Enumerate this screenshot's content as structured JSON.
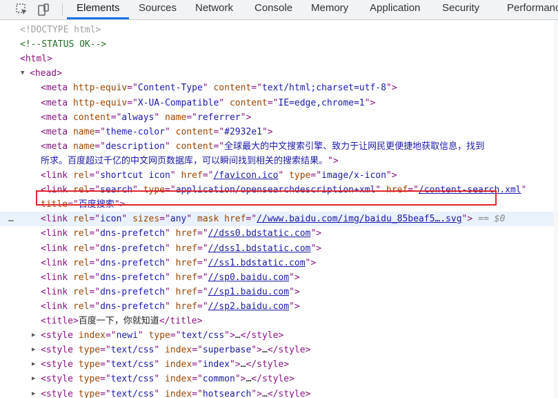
{
  "tabs": [
    "Elements",
    "Sources",
    "Network",
    "Console",
    "Memory",
    "Application",
    "Security",
    "Performance"
  ],
  "active_tab": "Elements",
  "colors": {
    "accent": "#1a73e8",
    "highlight_box": "#e0252b",
    "tag": "#881280",
    "attr": "#994500",
    "value": "#1a1aa6"
  },
  "selected_suffix": "== $0",
  "lines": [
    [
      "<!DOCTYPE html>"
    ],
    [
      "<!--STATUS OK-->"
    ],
    [
      "<html>"
    ],
    [
      "<head>"
    ],
    [
      "<meta",
      " http-equiv",
      "=\"",
      "Content-Type",
      "\"",
      " content",
      "=\"",
      "text/html;charset=utf-8",
      "\">"
    ],
    [
      "<meta",
      " http-equiv",
      "=\"",
      "X-UA-Compatible",
      "\"",
      " content",
      "=\"",
      "IE=edge,chrome=1",
      "\">"
    ],
    [
      "<meta",
      " content",
      "=\"",
      "always",
      "\"",
      " name",
      "=\"",
      "referrer",
      "\">"
    ],
    [
      "<meta",
      " name",
      "=\"",
      "theme-color",
      "\"",
      " content",
      "=\"",
      "#2932e1",
      "\">"
    ],
    [
      "<meta",
      " name",
      "=\"",
      "description",
      "\"",
      " content",
      "=\"",
      "全球最大的中文搜索引擎、致力于让网民更便捷地获取信息，找到"
    ],
    [
      "所求。百度超过千亿的中文网页数据库，可以瞬间找到相关的搜索结果。",
      "\">"
    ],
    [
      "<link",
      " rel",
      "=\"",
      "shortcut icon",
      "\"",
      " href",
      "=\"",
      "/favicon.ico",
      "\"",
      " type",
      "=\"",
      "image/x-icon",
      "\">"
    ],
    [
      "<link",
      " rel",
      "=\"",
      "search",
      "\"",
      " type",
      "=\"",
      "application/opensearchdescription+xml",
      "\"",
      " href",
      "=\"",
      "/content-search.xml",
      "\""
    ],
    [
      "title",
      "=\"",
      "百度搜索",
      "\">"
    ],
    [
      "<link",
      " rel",
      "=\"",
      "icon",
      "\"",
      " sizes",
      "=\"",
      "any",
      "\"",
      " mask",
      " href",
      "=\"",
      "//www.baidu.com/img/baidu_85beaf5….svg",
      "\">"
    ],
    [
      "<link",
      " rel",
      "=\"",
      "dns-prefetch",
      "\"",
      " href",
      "=\"",
      "//dss0.bdstatic.com",
      "\">"
    ],
    [
      "<link",
      " rel",
      "=\"",
      "dns-prefetch",
      "\"",
      " href",
      "=\"",
      "//dss1.bdstatic.com",
      "\">"
    ],
    [
      "<link",
      " rel",
      "=\"",
      "dns-prefetch",
      "\"",
      " href",
      "=\"",
      "//ss1.bdstatic.com",
      "\">"
    ],
    [
      "<link",
      " rel",
      "=\"",
      "dns-prefetch",
      "\"",
      " href",
      "=\"",
      "//sp0.baidu.com",
      "\">"
    ],
    [
      "<link",
      " rel",
      "=\"",
      "dns-prefetch",
      "\"",
      " href",
      "=\"",
      "//sp1.baidu.com",
      "\">"
    ],
    [
      "<link",
      " rel",
      "=\"",
      "dns-prefetch",
      "\"",
      " href",
      "=\"",
      "//sp2.baidu.com",
      "\">"
    ],
    [
      "<title>",
      "百度一下，你就知道",
      "</title>"
    ],
    [
      "<style",
      " index",
      "=\"",
      "newi",
      "\"",
      " type",
      "=\"",
      "text/css",
      "\">",
      "…",
      "</style>"
    ],
    [
      "<style",
      " type",
      "=\"",
      "text/css",
      "\"",
      " index",
      "=\"",
      "superbase",
      "\">",
      "…",
      "</style>"
    ],
    [
      "<style",
      " type",
      "=\"",
      "text/css",
      "\"",
      " index",
      "=\"",
      "index",
      "\">",
      "…",
      "</style>"
    ],
    [
      "<style",
      " type",
      "=\"",
      "text/css",
      "\"",
      " index",
      "=\"",
      "common",
      "\">",
      "…",
      "</style>"
    ],
    [
      "<style",
      " type",
      "=\"",
      "text/css",
      "\"",
      " index",
      "=\"",
      "hotsearch",
      "\">",
      "…",
      "</style>"
    ]
  ]
}
